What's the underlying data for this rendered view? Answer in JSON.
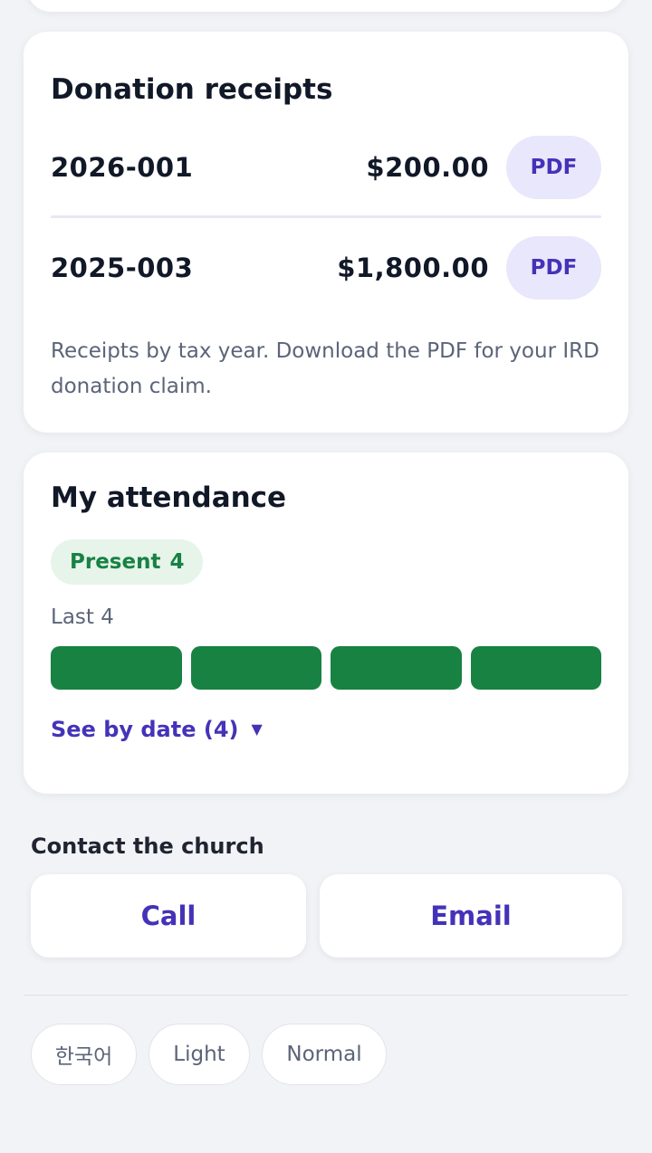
{
  "receipts": {
    "title": "Donation receipts",
    "items": [
      {
        "id": "2026-001",
        "amount": "$200.00",
        "button_label": "PDF"
      },
      {
        "id": "2025-003",
        "amount": "$1,800.00",
        "button_label": "PDF"
      }
    ],
    "note": "Receipts by tax year. Download the PDF for your IRD donation claim."
  },
  "attendance": {
    "title": "My attendance",
    "present_label": "Present",
    "present_count": "4",
    "last_label": "Last 4",
    "bars": [
      "present",
      "present",
      "present",
      "present"
    ],
    "see_by_date_label": "See by date (4)",
    "caret": "▼"
  },
  "contact": {
    "heading": "Contact the church",
    "call_label": "Call",
    "email_label": "Email"
  },
  "footer": {
    "language_label": "한국어",
    "theme_label": "Light",
    "text_size_label": "Normal"
  },
  "colors": {
    "accent": "#4433b8",
    "present": "#178242",
    "present_bg": "#e6f4ea",
    "pdf_bg": "#e8e7fb",
    "page_bg": "#f2f3f7"
  }
}
